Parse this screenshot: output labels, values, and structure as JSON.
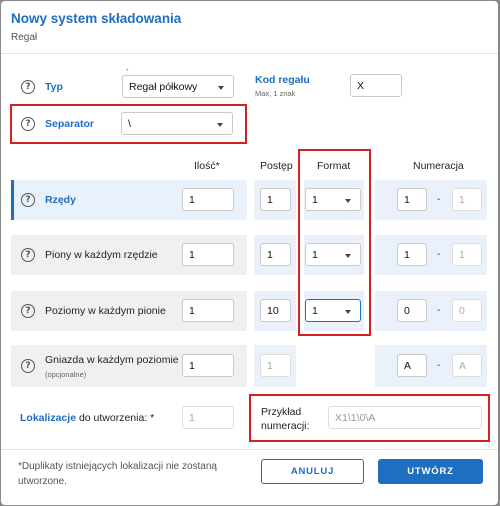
{
  "dialog": {
    "title": "Nowy system składowania",
    "subtitle": "Regał"
  },
  "typ": {
    "label": "Typ",
    "value": "Regał półkowy",
    "required_mark": "*"
  },
  "kod": {
    "label": "Kod regału",
    "hint": "Max, 1 znak",
    "value": "X"
  },
  "separator": {
    "label": "Separator",
    "value": "\\"
  },
  "headers": {
    "ilosc": "Ilość*",
    "postep": "Postęp",
    "format": "Format",
    "numeracja": "Numeracja"
  },
  "rows": [
    {
      "label": "Rzędy",
      "ilosc": "1",
      "postep": "1",
      "format": "1",
      "num_from": "1",
      "num_to": "1"
    },
    {
      "label": "Piony w każdym rzędzie",
      "ilosc": "1",
      "postep": "1",
      "format": "1",
      "num_from": "1",
      "num_to": "1"
    },
    {
      "label": "Poziomy w każdym pionie",
      "ilosc": "1",
      "postep": "10",
      "format": "1",
      "num_from": "0",
      "num_to": "0"
    },
    {
      "label": "Gniazda w każdym poziomie",
      "sublabel": "(opcjonalne)",
      "ilosc": "1",
      "postep": "1",
      "num_from": "A",
      "num_to": "A"
    }
  ],
  "dash": "-",
  "lokalizacje": {
    "label_strong": "Lokalizacje",
    "label_rest": " do utworzenia: *",
    "value": "1"
  },
  "przyklad": {
    "label_line1": "Przykład",
    "label_line2": "numeracji:",
    "value": "X1\\1\\0\\A"
  },
  "footer": {
    "note": "*Duplikaty istniejących lokalizacji nie zostaną utworzone.",
    "cancel": "ANULUJ",
    "create": "UTWÓRZ"
  },
  "colors": {
    "accent": "#1e6fc0",
    "highlight": "#d32020"
  },
  "icons": {
    "help": "question-circle-icon",
    "dropdown": "caret-down-icon"
  }
}
